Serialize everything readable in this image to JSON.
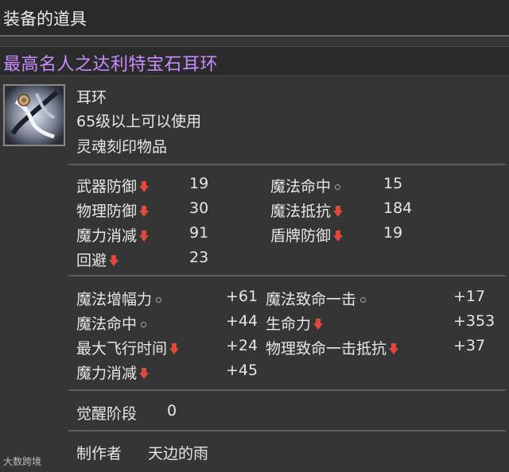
{
  "header": {
    "title": "装备的道具"
  },
  "item": {
    "name": "最高名人之达利特宝石耳环",
    "name_color": "#c78cff",
    "type": "耳环",
    "level_req": "65级以上可以使用",
    "soul_bound": "灵魂刻印物品",
    "icon": "earring-icon"
  },
  "base_stats": [
    {
      "label": "武器防御",
      "value": "19",
      "indicator": "down-arrow-icon"
    },
    {
      "label": "物理防御",
      "value": "30",
      "indicator": "down-arrow-icon"
    },
    {
      "label": "魔力消减",
      "value": "91",
      "indicator": "down-arrow-icon"
    },
    {
      "label": "回避",
      "value": "23",
      "indicator": "down-arrow-icon"
    },
    {
      "label": "魔法命中",
      "value": "15",
      "indicator": "dot-icon"
    },
    {
      "label": "魔法抵抗",
      "value": "184",
      "indicator": "down-arrow-icon"
    },
    {
      "label": "盾牌防御",
      "value": "19",
      "indicator": "down-arrow-icon"
    }
  ],
  "bonus_stats": [
    {
      "label": "魔法增幅力",
      "value": "+61",
      "indicator": "dot-icon"
    },
    {
      "label": "魔法命中",
      "value": "+44",
      "indicator": "dot-icon"
    },
    {
      "label": "最大飞行时间",
      "value": "+24",
      "indicator": "down-arrow-icon"
    },
    {
      "label": "魔力消减",
      "value": "+45",
      "indicator": "down-arrow-icon"
    },
    {
      "label": "魔法致命一击",
      "value": "+17",
      "indicator": "dot-icon"
    },
    {
      "label": "生命力",
      "value": "+353",
      "indicator": "down-arrow-icon"
    },
    {
      "label": "物理致命一击抵抗",
      "value": "+37",
      "indicator": "down-arrow-icon"
    }
  ],
  "awakening": {
    "label": "觉醒阶段",
    "value": "0"
  },
  "crafter": {
    "label": "制作者",
    "value": "天边的雨"
  },
  "watermark": "大数跨境",
  "colors": {
    "down_arrow": "#e0483a",
    "divider": "#5c5c5c"
  }
}
